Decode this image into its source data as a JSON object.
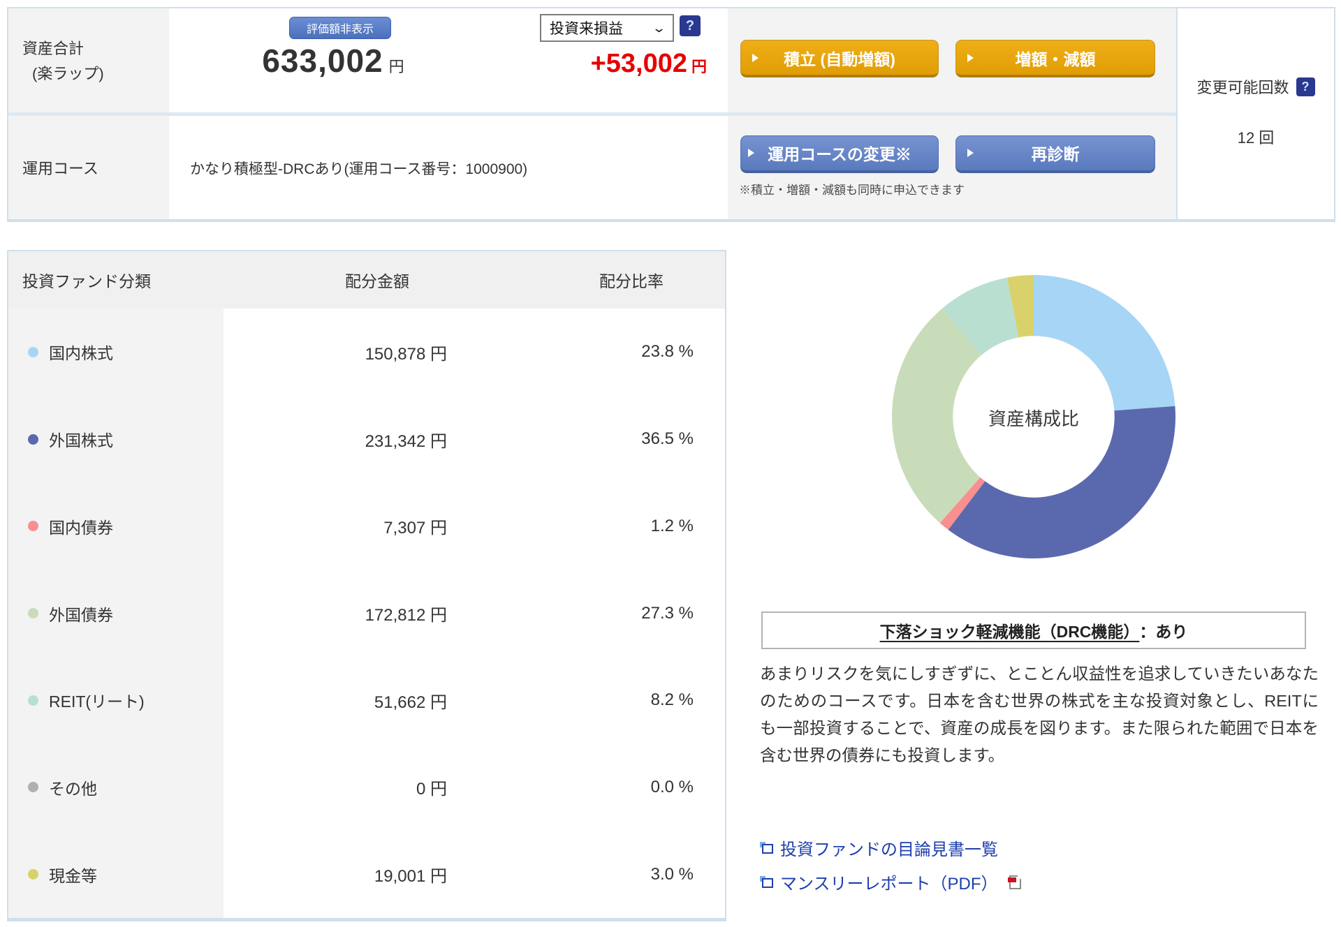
{
  "colors": {
    "border_light": "#cfe0ec",
    "cell_gray": "#f3f3f3",
    "accent_gold": "#e8a511",
    "accent_blue": "#6484c5",
    "help_navy": "#2b3890",
    "profit_red": "#e60000",
    "link_blue": "#1e3fae"
  },
  "summary": {
    "assets_label_1": "資産合計",
    "assets_label_2": "(楽ラップ)",
    "hide_button": "評価額非表示",
    "total_amount": "633,002",
    "total_unit": "円",
    "period_select": "投資来損益",
    "help_icon": "?",
    "profit_amount": "+53,002",
    "profit_unit": "円",
    "tsumitate_button": "積立 (自動増額)",
    "zougaku_button": "増額・減額",
    "course_label": "運用コース",
    "course_value": "かなり積極型-DRCあり(運用コース番号：1000900)",
    "course_change_button": "運用コースの変更※",
    "rediagnosis_button": "再診断",
    "buttons_note": "※積立・増額・減額も同時に申込できます",
    "change_count_label": "変更可能回数",
    "change_count_value": "12 回"
  },
  "allocation_table": {
    "headers": [
      "投資ファンド分類",
      "配分金額",
      "配分比率"
    ],
    "rows": [
      {
        "label": "国内株式",
        "amount": "150,878 円",
        "ratio": "23.8 %",
        "color": "#a7d5f5"
      },
      {
        "label": "外国株式",
        "amount": "231,342 円",
        "ratio": "36.5 %",
        "color": "#5a69ae"
      },
      {
        "label": "国内債券",
        "amount": "7,307 円",
        "ratio": "1.2 %",
        "color": "#f98f8f"
      },
      {
        "label": "外国債券",
        "amount": "172,812 円",
        "ratio": "27.3 %",
        "color": "#c9dcba"
      },
      {
        "label": "REIT(リート)",
        "amount": "51,662 円",
        "ratio": "8.2 %",
        "color": "#b9dfd1"
      },
      {
        "label": "その他",
        "amount": "0 円",
        "ratio": "0.0 %",
        "color": "#b0b0b0"
      },
      {
        "label": "現金等",
        "amount": "19,001 円",
        "ratio": "3.0 %",
        "color": "#d9d26c"
      }
    ]
  },
  "chart_data": {
    "type": "pie",
    "subtype": "donut",
    "center_label": "資産構成比",
    "labels": [
      "国内株式",
      "外国株式",
      "国内債券",
      "外国債券",
      "REIT(リート)",
      "現金等"
    ],
    "values": [
      23.8,
      36.5,
      1.2,
      27.3,
      8.2,
      3.0
    ],
    "colors": [
      "#a7d5f5",
      "#5a69ae",
      "#f98f8f",
      "#c9dcba",
      "#b9dfd1",
      "#d9d26c"
    ],
    "start_angle_deg": -90,
    "direction": "clockwise",
    "inner_radius_ratio": 0.57
  },
  "course_info": {
    "drc_title": "下落ショック軽減機能（DRC機能）",
    "drc_value": "：あり",
    "description": "あまりリスクを気にしすぎずに、とことん収益性を追求していきたいあなたのためのコースです。日本を含む世界の株式を主な投資対象とし、REITにも一部投資することで、資産の成長を図ります。また限られた範囲で日本を含む世界の債券にも投資します。",
    "links": [
      {
        "text": "投資ファンドの目論見書一覧"
      },
      {
        "text": "マンスリーレポート（PDF）"
      }
    ]
  }
}
